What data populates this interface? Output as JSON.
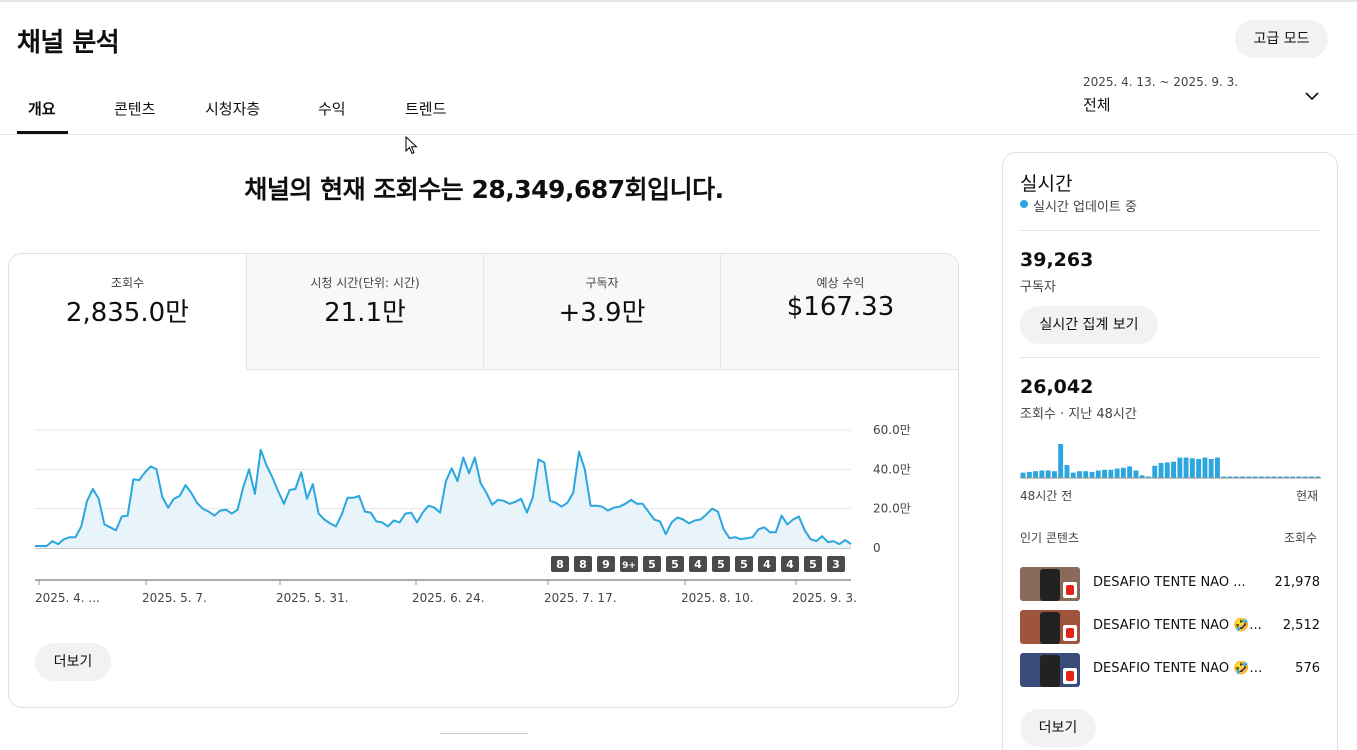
{
  "page": {
    "title": "채널 분석",
    "advanced_mode_label": "고급 모드"
  },
  "tabs": [
    {
      "label": "개요",
      "active": true
    },
    {
      "label": "콘텐츠",
      "active": false
    },
    {
      "label": "시청자층",
      "active": false
    },
    {
      "label": "수익",
      "active": false
    },
    {
      "label": "트렌드",
      "active": false
    }
  ],
  "date_picker": {
    "range": "2025. 4. 13. ~ 2025. 9. 3.",
    "scope": "전체",
    "icon": "chevron-down-icon"
  },
  "headline": "채널의 현재 조회수는 28,349,687회입니다.",
  "metrics": [
    {
      "label": "조회수",
      "value": "2,835.0만",
      "active": true
    },
    {
      "label": "시청 시간(단위: 시간)",
      "value": "21.1만",
      "active": false
    },
    {
      "label": "구독자",
      "value": "+3.9만",
      "active": false
    },
    {
      "label": "예상 수익",
      "value": "$167.33",
      "active": false
    }
  ],
  "chart_data": {
    "type": "area",
    "metric": "조회수",
    "x_tick_labels": [
      "2025. 4. ...",
      "2025. 5. 7.",
      "2025. 5. 31.",
      "2025. 6. 24.",
      "2025. 7. 17.",
      "2025. 8. 10.",
      "2025. 9. 3."
    ],
    "y_tick_labels": [
      "0",
      "20.0만",
      "40.0만",
      "60.0만"
    ],
    "ylim": [
      0,
      600000
    ],
    "grid": true,
    "color": "#2ba6de",
    "fill_color": "#e8f4fa",
    "x_start": "2025-04-13",
    "x_end": "2025-09-03",
    "values": [
      10000,
      10000,
      10000,
      35000,
      20000,
      45000,
      55000,
      55000,
      110000,
      240000,
      300000,
      250000,
      120000,
      105000,
      90000,
      160000,
      165000,
      350000,
      345000,
      385000,
      415000,
      400000,
      260000,
      205000,
      250000,
      265000,
      320000,
      280000,
      230000,
      200000,
      185000,
      165000,
      190000,
      195000,
      175000,
      195000,
      310000,
      400000,
      275000,
      500000,
      420000,
      360000,
      290000,
      225000,
      295000,
      300000,
      385000,
      250000,
      325000,
      175000,
      145000,
      125000,
      110000,
      170000,
      255000,
      255000,
      265000,
      185000,
      180000,
      135000,
      130000,
      110000,
      140000,
      130000,
      175000,
      180000,
      130000,
      180000,
      215000,
      205000,
      180000,
      340000,
      405000,
      340000,
      460000,
      380000,
      460000,
      330000,
      280000,
      220000,
      245000,
      240000,
      225000,
      235000,
      250000,
      180000,
      255000,
      450000,
      435000,
      240000,
      230000,
      210000,
      230000,
      280000,
      490000,
      400000,
      215000,
      215000,
      210000,
      190000,
      205000,
      210000,
      225000,
      245000,
      225000,
      225000,
      185000,
      145000,
      135000,
      70000,
      130000,
      155000,
      145000,
      125000,
      140000,
      145000,
      170000,
      200000,
      185000,
      95000,
      50000,
      55000,
      45000,
      50000,
      55000,
      95000,
      105000,
      80000,
      80000,
      165000,
      120000,
      145000,
      160000,
      90000,
      45000,
      35000,
      60000,
      30000,
      35000,
      20000,
      40000,
      20000
    ],
    "video_markers": [
      "8",
      "8",
      "9",
      "9+",
      "5",
      "5",
      "4",
      "5",
      "5",
      "4",
      "4",
      "5",
      "3"
    ]
  },
  "chart_more_label": "더보기",
  "realtime": {
    "title": "실시간",
    "status": "실시간 업데이트 중",
    "subscribers_value": "39,263",
    "subscribers_label": "구독자",
    "live_count_button": "실시간 집계 보기",
    "views_value": "26,042",
    "views_label": "조회수 · 지난 48시간",
    "bar_values": [
      0.16,
      0.18,
      0.2,
      0.22,
      0.22,
      0.2,
      1.0,
      0.38,
      0.16,
      0.2,
      0.2,
      0.18,
      0.22,
      0.24,
      0.24,
      0.28,
      0.3,
      0.34,
      0.22,
      0.08,
      0.04,
      0.36,
      0.44,
      0.46,
      0.48,
      0.6,
      0.6,
      0.58,
      0.56,
      0.6,
      0.56,
      0.6,
      0.02,
      0.02,
      0.02,
      0.02,
      0.02,
      0.02,
      0.02,
      0.02,
      0.02,
      0.02,
      0.02,
      0.02,
      0.02,
      0.02,
      0.02,
      0.02
    ],
    "axis_start": "48시간 전",
    "axis_end": "현재",
    "top_content_header": "인기 콘텐츠",
    "top_content_metric": "조회수",
    "top_content": [
      {
        "title": "DESAFIO TENTE NÃO ...",
        "views": "21,978",
        "thumb_color": "#8a6a5a"
      },
      {
        "title": "DESAFIO TENTE NÃO 🤣...",
        "views": "2,512",
        "thumb_color": "#a0533d"
      },
      {
        "title": "DESAFIO TENTE NÃO 🤣 R...",
        "views": "576",
        "thumb_color": "#3a4d7a"
      }
    ],
    "more_label": "더보기"
  }
}
